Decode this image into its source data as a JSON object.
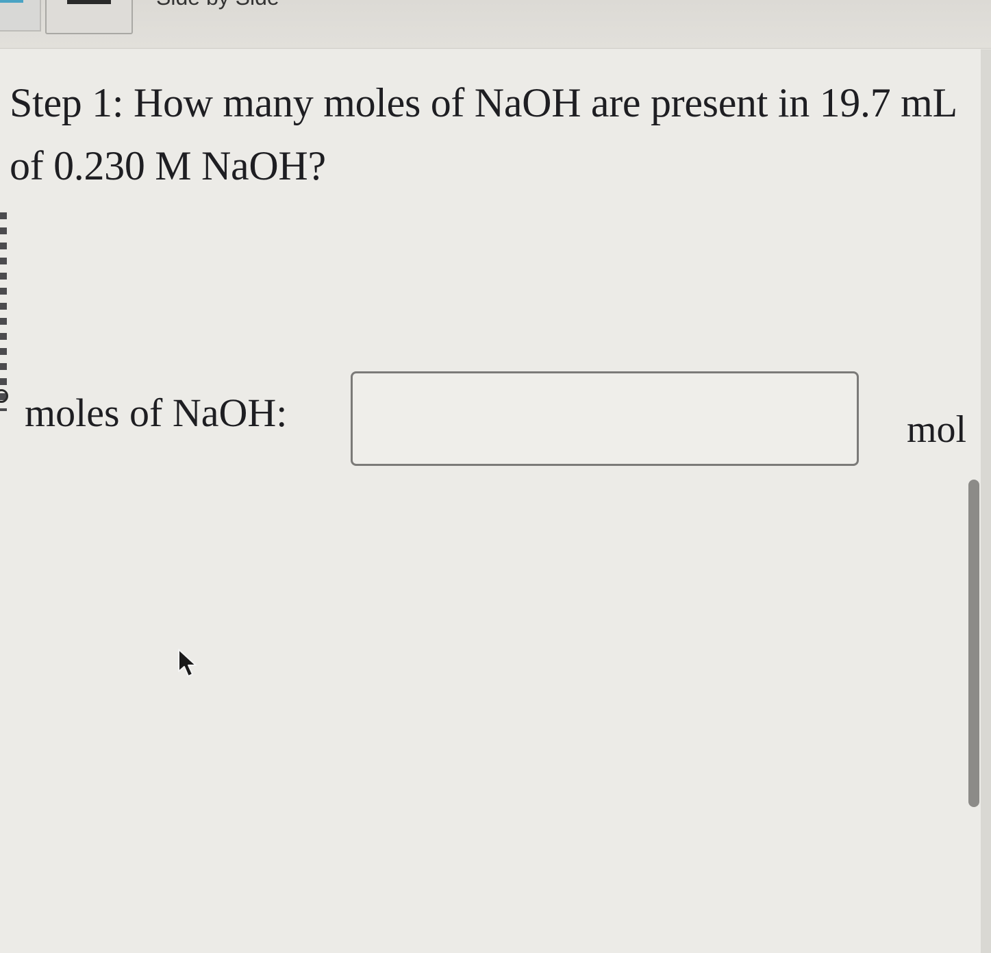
{
  "toolbar": {
    "label": "Side by Side"
  },
  "question": {
    "text": "Step 1: How many moles of NaOH are present in 19.7 mL of 0.230 M NaOH?"
  },
  "answer": {
    "label": "moles of NaOH:",
    "value": "",
    "placeholder": "",
    "unit": "mol"
  },
  "colors": {
    "background": "#ecebe7",
    "text": "#1e1e22",
    "input_border": "#7b7a78",
    "accent": "#4aa3c4"
  }
}
